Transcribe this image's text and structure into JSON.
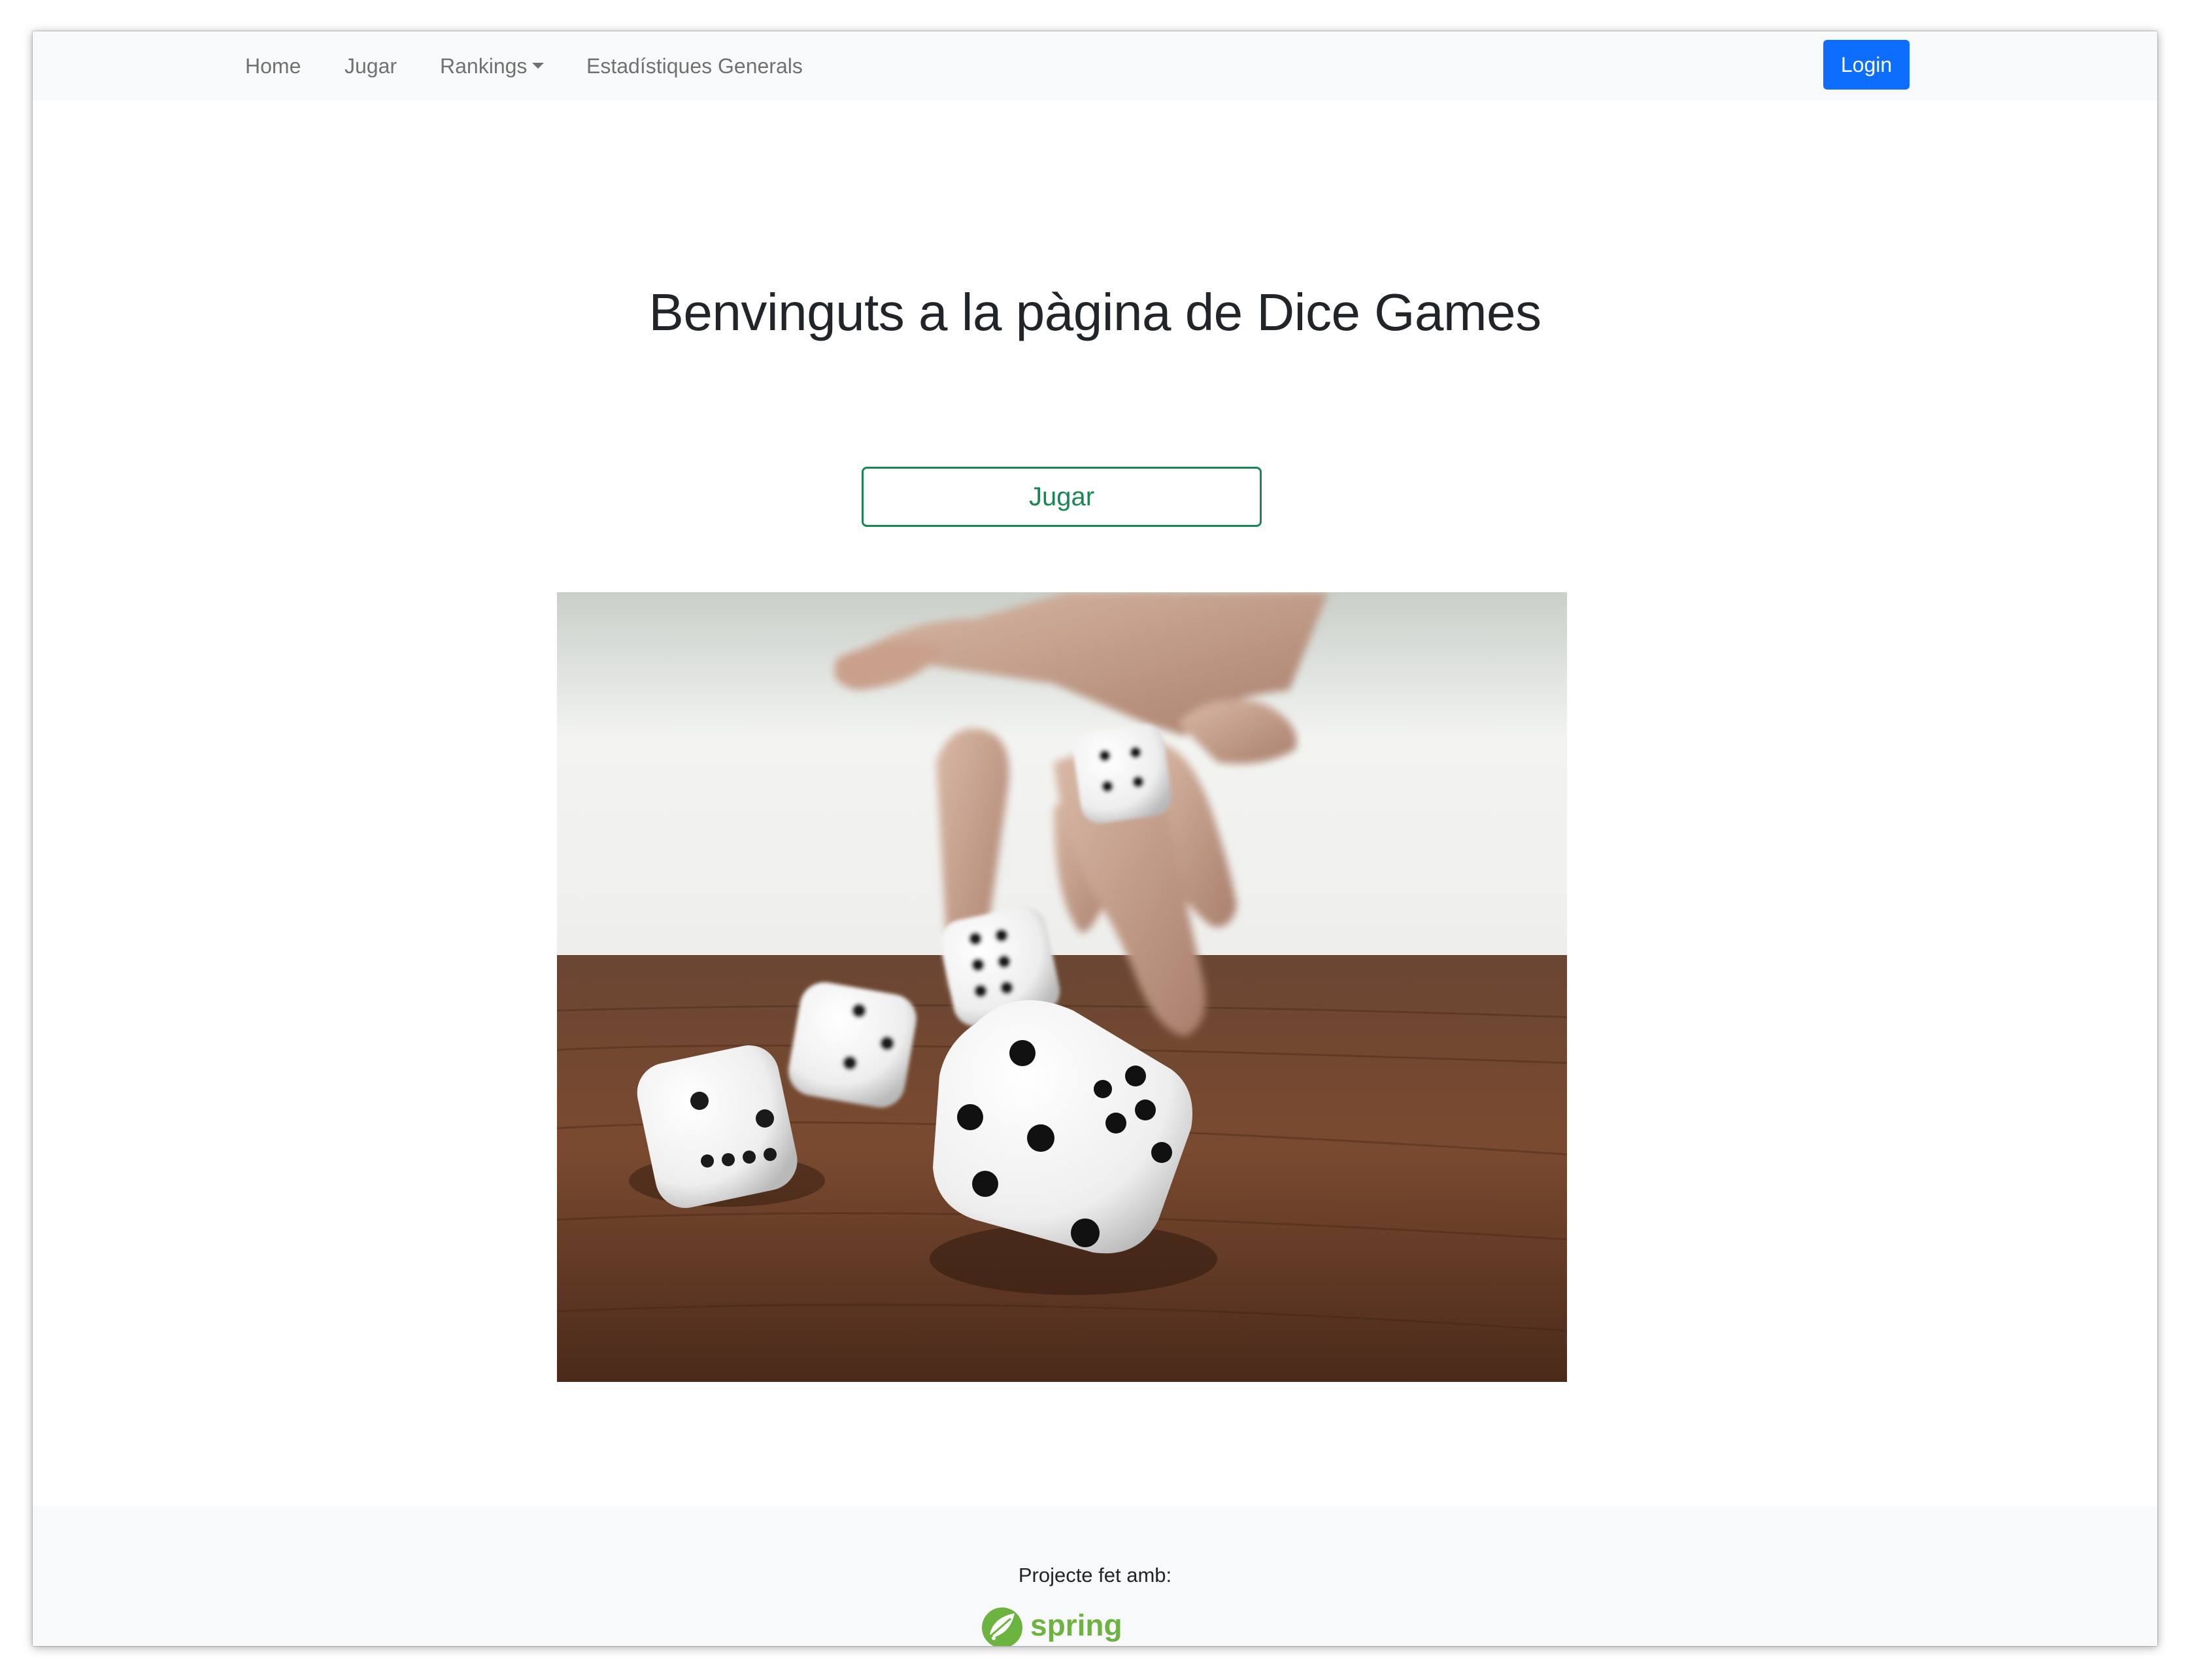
{
  "nav": {
    "home": "Home",
    "play": "Jugar",
    "rankings": "Rankings",
    "stats": "Estadístiques Generals",
    "login": "Login"
  },
  "main": {
    "title": "Benvinguts a la pàgina de Dice Games",
    "play_button": "Jugar",
    "image_icon": "dice-photo"
  },
  "footer": {
    "text": "Projecte fet amb:",
    "logo_text": "spring",
    "logo_icon": "spring-leaf-icon"
  },
  "colors": {
    "login_bg": "#0d6efd",
    "play_outline": "#198754",
    "spring_green": "#6db33f",
    "navbar_bg": "#f8f9fa"
  }
}
